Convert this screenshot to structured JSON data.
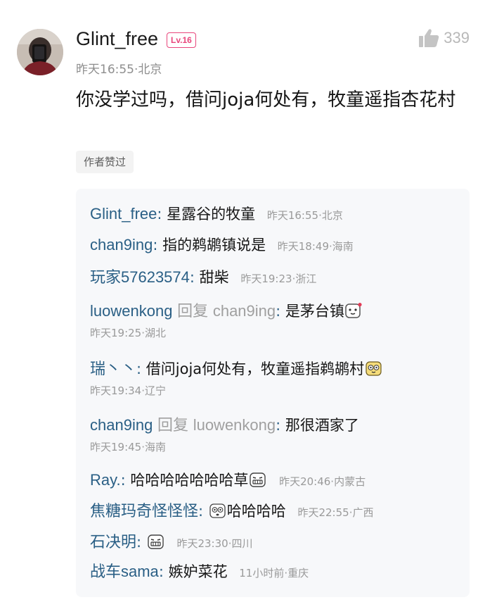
{
  "comment": {
    "username": "Glint_free",
    "level": "Lv.16",
    "time": "昨天16:55",
    "location": "北京",
    "like_count": "339",
    "text": "你没学过吗，借问joja何处有，牧童遥指杏花村",
    "author_liked": "作者赞过"
  },
  "replies": [
    {
      "name": "Glint_free",
      "text": "星露谷的牧童",
      "time": "昨天16:55",
      "location": "北京"
    },
    {
      "name": "chan9ing",
      "text": "指的鹈鹕镇说是",
      "time": "昨天18:49",
      "location": "海南"
    },
    {
      "name": "玩家57623574",
      "text": "甜柴",
      "time": "昨天19:23",
      "location": "浙江"
    },
    {
      "name": "luowenkong",
      "reply_word": "回复",
      "target": "chan9ing",
      "text": "是茅台镇",
      "emoji": "heart-smile-emoji",
      "time": "昨天19:25",
      "location": "湖北"
    },
    {
      "name": "瑞丶丶",
      "text": "借问joja何处有，牧童遥指鹈鹕村",
      "emoji": "dizzy-face-emoji",
      "time": "昨天19:34",
      "location": "辽宁"
    },
    {
      "name": "chan9ing",
      "reply_word": "回复",
      "target": "luowenkong",
      "text": "那很酒家了",
      "time": "昨天19:45",
      "location": "海南"
    },
    {
      "name": "Ray.",
      "text": "哈哈哈哈哈哈哈草",
      "emoji": "grimace-emoji",
      "time": "昨天20:46",
      "location": "内蒙古"
    },
    {
      "name": "焦糖玛奇怪怪怪",
      "emoji_prefix": "dizzy-face-emoji",
      "text": "哈哈哈哈",
      "time": "昨天22:55",
      "location": "广西"
    },
    {
      "name": "石决明",
      "emoji": "grimace-emoji",
      "time": "昨天23:30",
      "location": "四川"
    },
    {
      "name": "战车sama",
      "text": "嫉妒菜花",
      "time": "11小时前",
      "location": "重庆"
    }
  ],
  "colors": {
    "name_blue": "#2a5f85",
    "badge_pink": "#e8467c",
    "meta_gray": "#9a9a9a"
  }
}
